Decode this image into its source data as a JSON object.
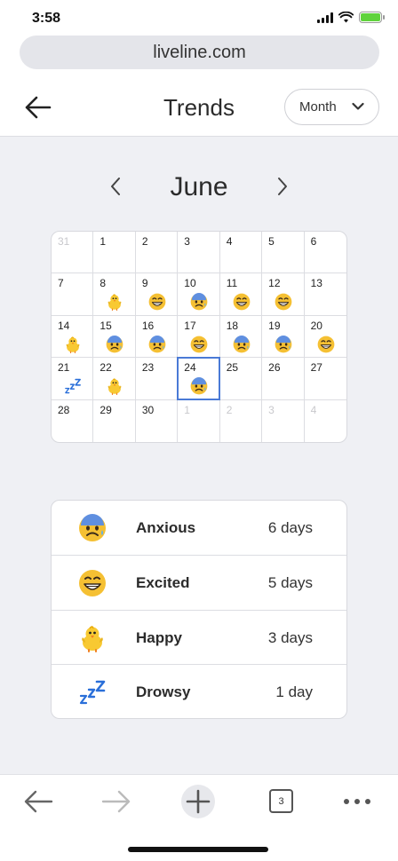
{
  "status": {
    "time": "3:58"
  },
  "browser": {
    "url": "liveline.com",
    "tabs_count": "3"
  },
  "header": {
    "title": "Trends",
    "period_selector": "Month"
  },
  "calendar": {
    "month": "June",
    "days": [
      {
        "num": "31",
        "muted": true,
        "mood": null
      },
      {
        "num": "1",
        "muted": false,
        "mood": null
      },
      {
        "num": "2",
        "muted": false,
        "mood": null
      },
      {
        "num": "3",
        "muted": false,
        "mood": null
      },
      {
        "num": "4",
        "muted": false,
        "mood": null
      },
      {
        "num": "5",
        "muted": false,
        "mood": null
      },
      {
        "num": "6",
        "muted": false,
        "mood": null
      },
      {
        "num": "7",
        "muted": false,
        "mood": null
      },
      {
        "num": "8",
        "muted": false,
        "mood": "happy"
      },
      {
        "num": "9",
        "muted": false,
        "mood": "excited"
      },
      {
        "num": "10",
        "muted": false,
        "mood": "anxious"
      },
      {
        "num": "11",
        "muted": false,
        "mood": "excited"
      },
      {
        "num": "12",
        "muted": false,
        "mood": "excited"
      },
      {
        "num": "13",
        "muted": false,
        "mood": null
      },
      {
        "num": "14",
        "muted": false,
        "mood": "happy"
      },
      {
        "num": "15",
        "muted": false,
        "mood": "anxious"
      },
      {
        "num": "16",
        "muted": false,
        "mood": "anxious"
      },
      {
        "num": "17",
        "muted": false,
        "mood": "excited"
      },
      {
        "num": "18",
        "muted": false,
        "mood": "anxious"
      },
      {
        "num": "19",
        "muted": false,
        "mood": "anxious"
      },
      {
        "num": "20",
        "muted": false,
        "mood": "excited"
      },
      {
        "num": "21",
        "muted": false,
        "mood": "drowsy"
      },
      {
        "num": "22",
        "muted": false,
        "mood": "happy"
      },
      {
        "num": "23",
        "muted": false,
        "mood": null
      },
      {
        "num": "24",
        "muted": false,
        "mood": "anxious",
        "selected": true
      },
      {
        "num": "25",
        "muted": false,
        "mood": null
      },
      {
        "num": "26",
        "muted": false,
        "mood": null
      },
      {
        "num": "27",
        "muted": false,
        "mood": null
      },
      {
        "num": "28",
        "muted": false,
        "mood": null
      },
      {
        "num": "29",
        "muted": false,
        "mood": null
      },
      {
        "num": "30",
        "muted": false,
        "mood": null
      },
      {
        "num": "1",
        "muted": true,
        "mood": null
      },
      {
        "num": "2",
        "muted": true,
        "mood": null
      },
      {
        "num": "3",
        "muted": true,
        "mood": null
      },
      {
        "num": "4",
        "muted": true,
        "mood": null
      }
    ]
  },
  "summary": [
    {
      "mood_key": "anxious",
      "label": "Anxious",
      "count": "6 days"
    },
    {
      "mood_key": "excited",
      "label": "Excited",
      "count": "5 days"
    },
    {
      "mood_key": "happy",
      "label": "Happy",
      "count": "3 days"
    },
    {
      "mood_key": "drowsy",
      "label": "Drowsy",
      "count": "1 day"
    }
  ],
  "icons": {
    "anxious": "anxious-face-icon",
    "excited": "grinning-face-icon",
    "happy": "chick-icon",
    "drowsy": "zzz-icon"
  },
  "colors": {
    "accent": "#4a7ad6",
    "battery": "#5fd33c",
    "anxious_face": "#f5c033",
    "anxious_forehead": "#5f8fe0",
    "chick": "#f8c932",
    "zzz": "#2a6fd9"
  }
}
